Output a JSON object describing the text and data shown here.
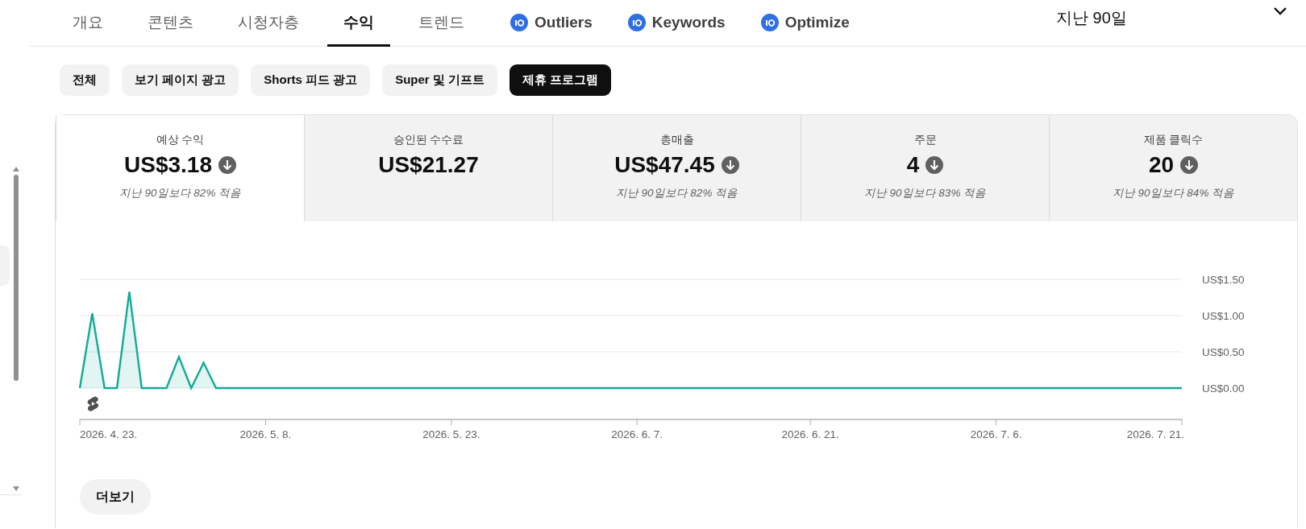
{
  "nav_tabs": [
    {
      "label": "개요",
      "selected": false,
      "kind": "text"
    },
    {
      "label": "콘텐츠",
      "selected": false,
      "kind": "text"
    },
    {
      "label": "시청자층",
      "selected": false,
      "kind": "text"
    },
    {
      "label": "수익",
      "selected": true,
      "kind": "text"
    },
    {
      "label": "트렌드",
      "selected": false,
      "kind": "text"
    },
    {
      "label": "Outliers",
      "selected": false,
      "kind": "extension"
    },
    {
      "label": "Keywords",
      "selected": false,
      "kind": "extension"
    },
    {
      "label": "Optimize",
      "selected": false,
      "kind": "extension"
    }
  ],
  "date_range": {
    "label": "지난 90일"
  },
  "filter_chips": [
    {
      "label": "전체",
      "selected": false
    },
    {
      "label": "보기 페이지 광고",
      "selected": false
    },
    {
      "label": "Shorts 피드 광고",
      "selected": false
    },
    {
      "label": "Super 및 기프트",
      "selected": false
    },
    {
      "label": "제휴 프로그램",
      "selected": true
    }
  ],
  "metrics": [
    {
      "label": "예상 수익",
      "value": "US$3.18",
      "decreased": true,
      "comparison": "지난 90일보다 82% 적음",
      "selected": true
    },
    {
      "label": "승인된 수수료",
      "value": "US$21.27",
      "decreased": false,
      "selected": false
    },
    {
      "label": "총매출",
      "value": "US$47.45",
      "decreased": true,
      "comparison": "지난 90일보다 82% 적음",
      "selected": false
    },
    {
      "label": "주문",
      "value": "4",
      "decreased": true,
      "comparison": "지난 90일보다 83% 적음",
      "selected": false
    },
    {
      "label": "제품 클릭수",
      "value": "20",
      "decreased": true,
      "comparison": "지난 90일보다 84% 적음",
      "selected": false
    }
  ],
  "chart": {
    "y_axis_labels": [
      "US$1.50",
      "US$1.00",
      "US$0.50",
      "US$0.00"
    ],
    "x_axis_labels": [
      "2026. 4. 23.",
      "2026. 5. 8.",
      "2026. 5. 23.",
      "2026. 6. 7.",
      "2026. 6. 21.",
      "2026. 7. 6.",
      "2026. 7. 21."
    ]
  },
  "more_button": {
    "label": "더보기"
  }
}
